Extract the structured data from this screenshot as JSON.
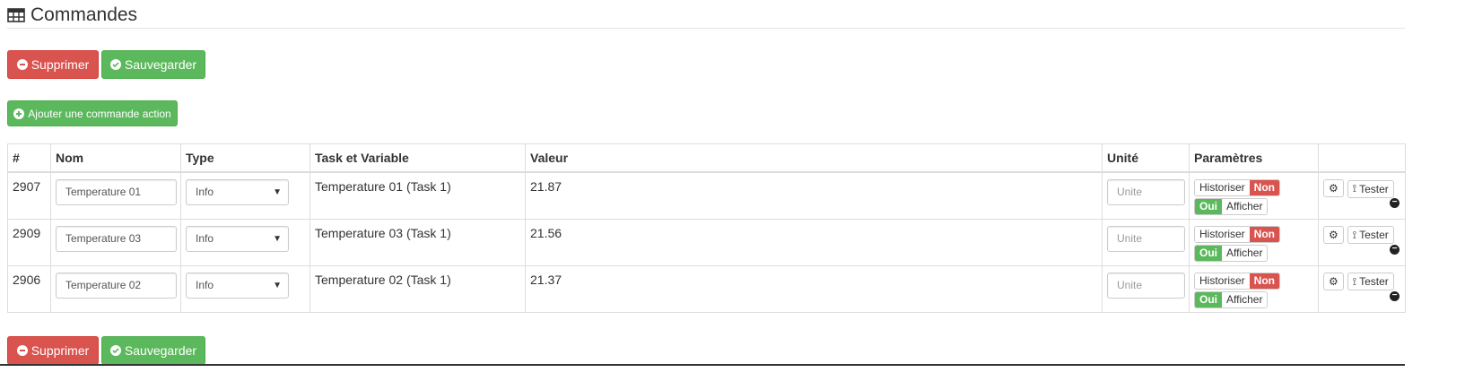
{
  "header": {
    "title": "Commandes",
    "icon": "table-icon"
  },
  "actions": {
    "delete_label": "Supprimer",
    "save_label": "Sauvegarder",
    "add_action_label": "Ajouter une commande action"
  },
  "table": {
    "headers": [
      "#",
      "Nom",
      "Type",
      "Task et Variable",
      "Valeur",
      "Unité",
      "Paramètres",
      ""
    ],
    "rows": [
      {
        "id": "2907",
        "name": "Temperature 01",
        "type": "Info",
        "task": "Temperature 01 (Task 1)",
        "value": "21.87",
        "unit_placeholder": "Unite",
        "historiser": "Historiser",
        "non": "Non",
        "oui": "Oui",
        "afficher": "Afficher",
        "tester": "Tester"
      },
      {
        "id": "2909",
        "name": "Temperature 03",
        "type": "Info",
        "task": "Temperature 03 (Task 1)",
        "value": "21.56",
        "unit_placeholder": "Unite",
        "historiser": "Historiser",
        "non": "Non",
        "oui": "Oui",
        "afficher": "Afficher",
        "tester": "Tester"
      },
      {
        "id": "2906",
        "name": "Temperature 02",
        "type": "Info",
        "task": "Temperature 02 (Task 1)",
        "value": "21.37",
        "unit_placeholder": "Unite",
        "historiser": "Historiser",
        "non": "Non",
        "oui": "Oui",
        "afficher": "Afficher",
        "tester": "Tester"
      }
    ]
  },
  "colors": {
    "danger": "#d9534f",
    "success": "#5cb85c"
  }
}
